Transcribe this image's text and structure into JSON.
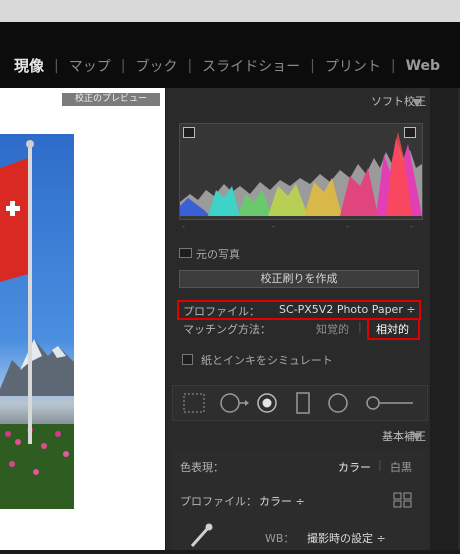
{
  "modules": {
    "items": [
      {
        "label": "現像",
        "active": true
      },
      {
        "label": "マップ",
        "active": false
      },
      {
        "label": "ブック",
        "active": false
      },
      {
        "label": "スライドショー",
        "active": false
      },
      {
        "label": "プリント",
        "active": false
      },
      {
        "label": "Web",
        "active": false
      }
    ]
  },
  "preview": {
    "badge": "校正のプレビュー"
  },
  "soft_proof": {
    "header": "ソフト校正",
    "original_photo_label": "元の写真",
    "create_proof_button": "校正刷りを作成",
    "profile_label": "プロファイル：",
    "profile_value": "SC-PX5V2 Photo Paper ÷",
    "matching_label": "マッチング方法：",
    "perceptual": "知覚的",
    "relative": "相対的",
    "simulate_label": "紙とインキをシミュレート",
    "ticks": [
      "-",
      "-",
      "-",
      "-"
    ]
  },
  "basic": {
    "header": "基本補正",
    "treatment_label": "色表現：",
    "color": "カラー",
    "bw": "白黒",
    "profile_label": "プロファイル：",
    "profile_value": "カラー ÷",
    "wb_label": "WB：",
    "wb_value": "撮影時の設定 ÷"
  },
  "colors": {
    "accent_red": "#e00000",
    "panel_bg": "#2a2a2a"
  }
}
